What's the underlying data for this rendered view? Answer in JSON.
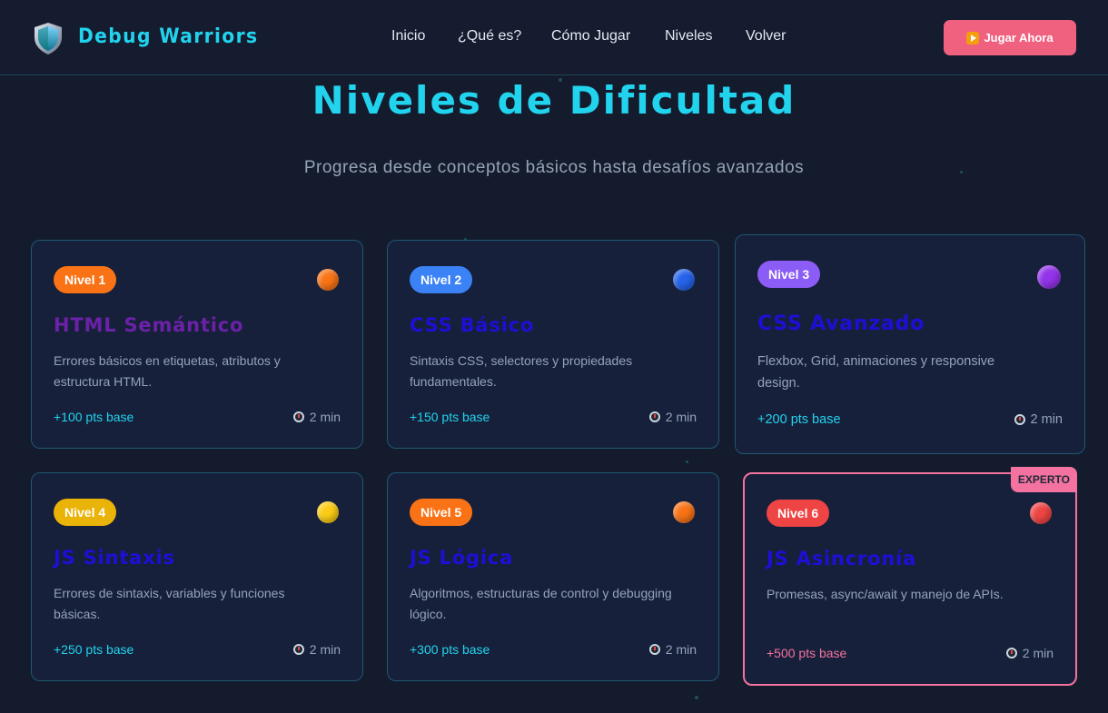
{
  "nav": {
    "brand": "Debug Warriors",
    "links": [
      "Inicio",
      "¿Qué es?",
      "Cómo Jugar",
      "Niveles",
      "Volver"
    ],
    "cta_label": "Jugar Ahora"
  },
  "page": {
    "title": "Niveles de Dificultad",
    "subtitle": "Progresa desde conceptos básicos hasta desafíos avanzados"
  },
  "levels": [
    {
      "badge": "Nivel 1",
      "title": "HTML Semántico",
      "desc": "Errores básicos en etiquetas, atributos y estructura HTML.",
      "points": "+100 pts base",
      "time": "2 min",
      "badge_color": "#f97316",
      "orb_color": "#f97316",
      "title_color": "#6b21a8",
      "points_color": "#22d3ee"
    },
    {
      "badge": "Nivel 2",
      "title": "CSS Básico",
      "desc": "Sintaxis CSS, selectores y propiedades fundamentales.",
      "points": "+150 pts base",
      "time": "2 min",
      "badge_color": "#3b82f6",
      "orb_color": "#2563eb",
      "title_color": "#1d0fd6",
      "points_color": "#22d3ee"
    },
    {
      "badge": "Nivel 3",
      "title": "CSS Avanzado",
      "desc": "Flexbox, Grid, animaciones y responsive design.",
      "points": "+200 pts base",
      "time": "2 min",
      "badge_color": "#8b5cf6",
      "orb_color": "#9333ea",
      "title_color": "#1d0fd6",
      "points_color": "#22d3ee"
    },
    {
      "badge": "Nivel 4",
      "title": "JS Sintaxis",
      "desc": "Errores de sintaxis, variables y funciones básicas.",
      "points": "+250 pts base",
      "time": "2 min",
      "badge_color": "#eab308",
      "orb_color": "#facc15",
      "title_color": "#1d0fd6",
      "points_color": "#22d3ee"
    },
    {
      "badge": "Nivel 5",
      "title": "JS Lógica",
      "desc": "Algoritmos, estructuras de control y debugging lógico.",
      "points": "+300 pts base",
      "time": "2 min",
      "badge_color": "#f97316",
      "orb_color": "#f97316",
      "title_color": "#1d0fd6",
      "points_color": "#22d3ee"
    },
    {
      "badge": "Nivel 6",
      "title": "JS Asincronía",
      "desc": "Promesas, async/await y manejo de APIs.",
      "points": "+500 pts base",
      "time": "2 min",
      "badge_color": "#ef4444",
      "orb_color": "#ef4444",
      "title_color": "#1d0fd6",
      "points_color": "#f472a0",
      "tag": "EXPERTO"
    }
  ]
}
